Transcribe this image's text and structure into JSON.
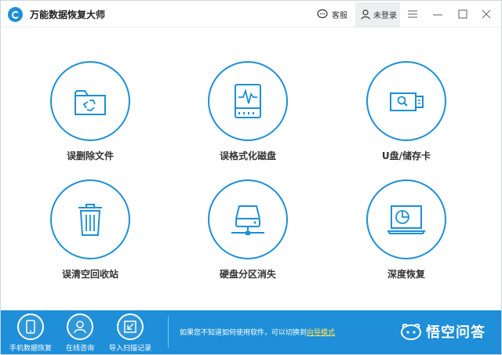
{
  "app": {
    "title": "万能数据恢复大师"
  },
  "titlebar": {
    "service_label": "客服",
    "login_label": "未登录"
  },
  "features": [
    {
      "label": "误删除文件",
      "icon": "folder-recycle-icon"
    },
    {
      "label": "误格式化磁盘",
      "icon": "disk-pulse-icon"
    },
    {
      "label": "U盘/储存卡",
      "icon": "usb-drive-icon"
    },
    {
      "label": "误清空回收站",
      "icon": "trash-bin-icon"
    },
    {
      "label": "硬盘分区消失",
      "icon": "hard-drive-network-icon"
    },
    {
      "label": "深度恢复",
      "icon": "monitor-scan-icon"
    }
  ],
  "bottom": {
    "items": [
      {
        "label": "手机数据恢复",
        "icon": "phone-icon"
      },
      {
        "label": "在线咨询",
        "icon": "consultant-icon"
      },
      {
        "label": "导入扫描记录",
        "icon": "import-icon"
      }
    ],
    "hint_text": "如果您不知道如何使用软件，可以切换到",
    "hint_link": "向导模式",
    "watermark": "悟空问答"
  },
  "colors": {
    "accent": "#1e8fd8",
    "link": "#ffe45c"
  }
}
